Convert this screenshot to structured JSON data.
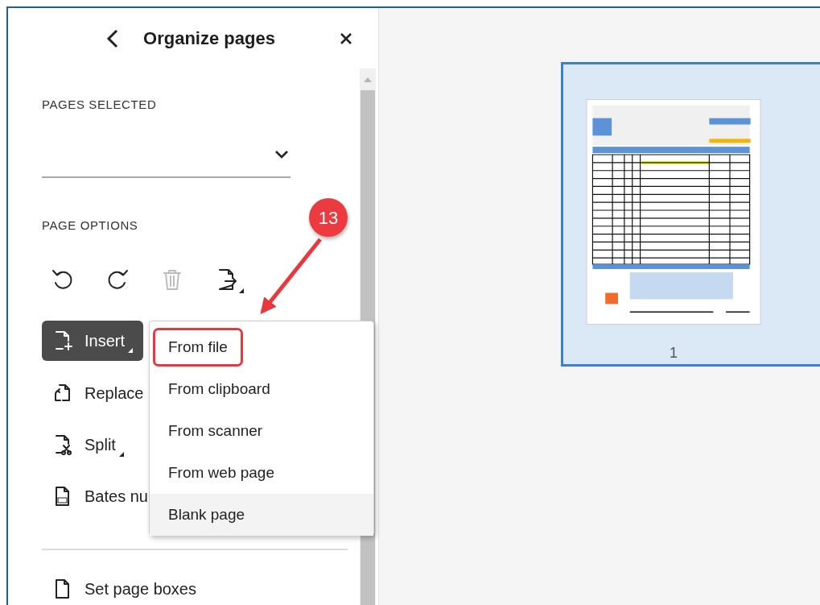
{
  "panel": {
    "title": "Organize pages",
    "pages_selected": {
      "label": "PAGES SELECTED"
    },
    "page_options": {
      "label": "PAGE OPTIONS"
    },
    "tools": [
      {
        "kind": "rotate-left",
        "disabled": false
      },
      {
        "kind": "rotate-right",
        "disabled": false
      },
      {
        "kind": "delete",
        "disabled": true
      },
      {
        "kind": "extract",
        "disabled": false,
        "dropdown": true
      }
    ],
    "actions": [
      {
        "kind": "insert",
        "label": "Insert",
        "selected": true,
        "dropdown": true
      },
      {
        "kind": "replace",
        "label": "Replace",
        "selected": false,
        "dropdown": false
      },
      {
        "kind": "split",
        "label": "Split",
        "selected": false,
        "dropdown": true
      },
      {
        "kind": "bates",
        "label": "Bates nu",
        "selected": false,
        "dropdown": false
      }
    ],
    "more_actions": [
      {
        "kind": "page-boxes",
        "label": "Set page boxes",
        "selected": false
      }
    ]
  },
  "insert_menu": {
    "items": [
      {
        "label": "From file",
        "hovered": false,
        "highlighted": true
      },
      {
        "label": "From clipboard",
        "hovered": false,
        "highlighted": false
      },
      {
        "label": "From scanner",
        "hovered": false,
        "highlighted": false
      },
      {
        "label": "From web page",
        "hovered": false,
        "highlighted": false
      },
      {
        "label": "Blank page",
        "hovered": true,
        "highlighted": false
      }
    ]
  },
  "annotation": {
    "number": "13"
  },
  "thumbnails": [
    {
      "label": "1",
      "selected": true,
      "kind": "picture"
    }
  ]
}
